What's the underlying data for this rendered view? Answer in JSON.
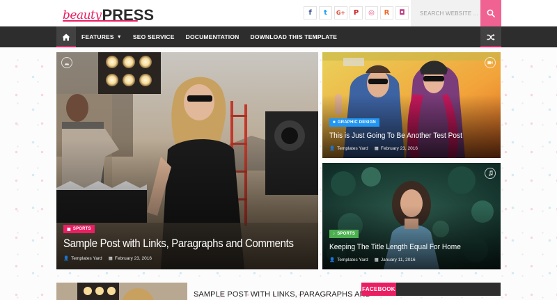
{
  "header": {
    "logo_script": "beauty",
    "logo_word": "PRESS",
    "social": [
      {
        "name": "facebook",
        "glyph": "f",
        "color": "#3b5998"
      },
      {
        "name": "twitter",
        "glyph": "t",
        "color": "#1da1f2"
      },
      {
        "name": "google-plus",
        "glyph": "G+",
        "color": "#dd4b39"
      },
      {
        "name": "pinterest",
        "glyph": "P",
        "color": "#cb2027"
      },
      {
        "name": "dribbble",
        "glyph": "◎",
        "color": "#ea4c89"
      },
      {
        "name": "rss",
        "glyph": "R",
        "color": "#f26522"
      },
      {
        "name": "instagram",
        "glyph": "◘",
        "color": "#c13584"
      }
    ],
    "search_placeholder": "SEARCH WEBSITE ...",
    "accent": "#e91e63"
  },
  "nav": {
    "items": [
      {
        "label": "FEATURES",
        "has_dropdown": true
      },
      {
        "label": "SEO SERVICE",
        "has_dropdown": false
      },
      {
        "label": "DOCUMENTATION",
        "has_dropdown": false
      },
      {
        "label": "DOWNLOAD THIS TEMPLATE",
        "has_dropdown": false
      }
    ]
  },
  "featured": {
    "main": {
      "category": "SPORTS",
      "category_color": "#e91e63",
      "title": "Sample Post with Links, Paragraphs and Comments",
      "author": "Templates Yard",
      "date": "February 23, 2016",
      "format_icon": "image-icon"
    },
    "top_right": {
      "category": "GRAPHIC DESIGN",
      "category_color": "#2196f3",
      "title": "This is Just Going To Be Another Test Post",
      "author": "Templates Yard",
      "date": "February 23, 2016",
      "format_icon": "video-icon"
    },
    "bottom_right": {
      "category": "SPORTS",
      "category_color": "#4caf50",
      "title": "Keeping The Title Length Equal For Home",
      "author": "Templates Yard",
      "date": "January 11, 2016",
      "format_icon": "music-icon"
    }
  },
  "below": {
    "post_title": "SAMPLE POST WITH LINKS, PARAGRAPHS AND",
    "widget_title": "FACEBOOK"
  }
}
